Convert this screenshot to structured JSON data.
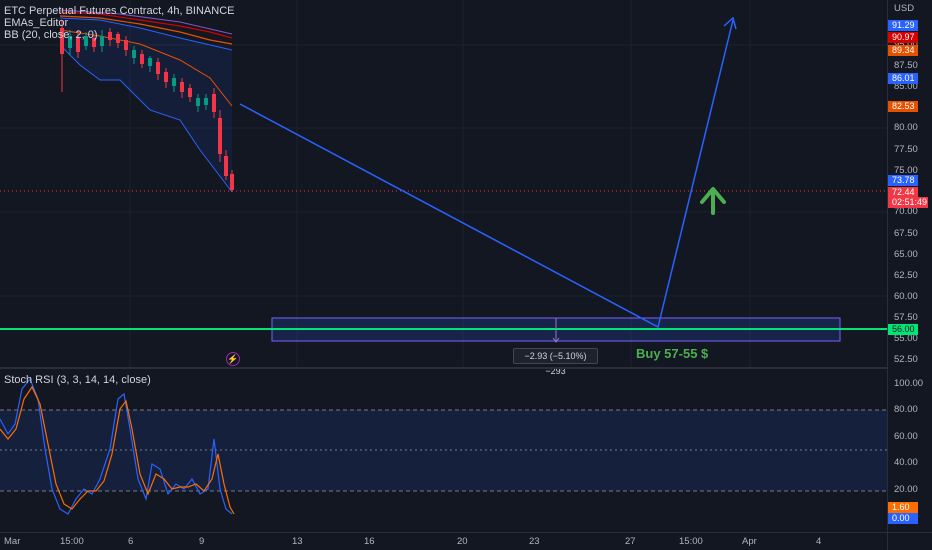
{
  "chart": {
    "symbol_legend": "ETC Perpetual Futures Contract, 4h, BINANCE",
    "indicator_1": "EMAs_Editor",
    "indicator_2": "BB (20, close, 2, 0)",
    "currency": "USD"
  },
  "price_axis": {
    "ticks": [
      "95.00",
      "87.50",
      "85.00",
      "80.00",
      "77.50",
      "75.00",
      "70.00",
      "67.50",
      "65.00",
      "62.50",
      "60.00",
      "57.50",
      "55.00",
      "52.50"
    ],
    "labels": {
      "ema_a": {
        "value": "91.29",
        "color": "#2962ff"
      },
      "ema_b": {
        "value": "90.97",
        "color": "#d50000"
      },
      "ema_c": {
        "value": "89.34",
        "color": "#e65100"
      },
      "bb_upper": {
        "value": "86.01",
        "color": "#2962ff"
      },
      "bb_basis": {
        "value": "82.53",
        "color": "#e65100"
      },
      "bb_lower": {
        "value": "73.78",
        "color": "#2962ff"
      },
      "last_price": {
        "value": "72.44",
        "color": "#f23645"
      },
      "countdown": "02:51:49",
      "support": {
        "value": "56.00",
        "color": "#00e676"
      }
    }
  },
  "osc_axis": {
    "ticks": [
      "100.00",
      "80.00",
      "60.00",
      "40.00",
      "20.00"
    ],
    "labels": {
      "k": {
        "value": "1.60",
        "color": "#ff6d00"
      },
      "d": {
        "value": "0.00",
        "color": "#2962ff"
      }
    }
  },
  "oscillator": {
    "legend": "Stoch RSI (3, 3, 14, 14, close)"
  },
  "time_axis": {
    "ticks": [
      "Mar",
      "15:00",
      "6",
      "9",
      "13",
      "16",
      "20",
      "23",
      "27",
      "15:00",
      "Apr",
      "4"
    ]
  },
  "annotations": {
    "measure": "−2.93 (−5.10%) −293",
    "buy_text": "Buy 57-55 $",
    "bolt_glyph": "⚡"
  }
}
